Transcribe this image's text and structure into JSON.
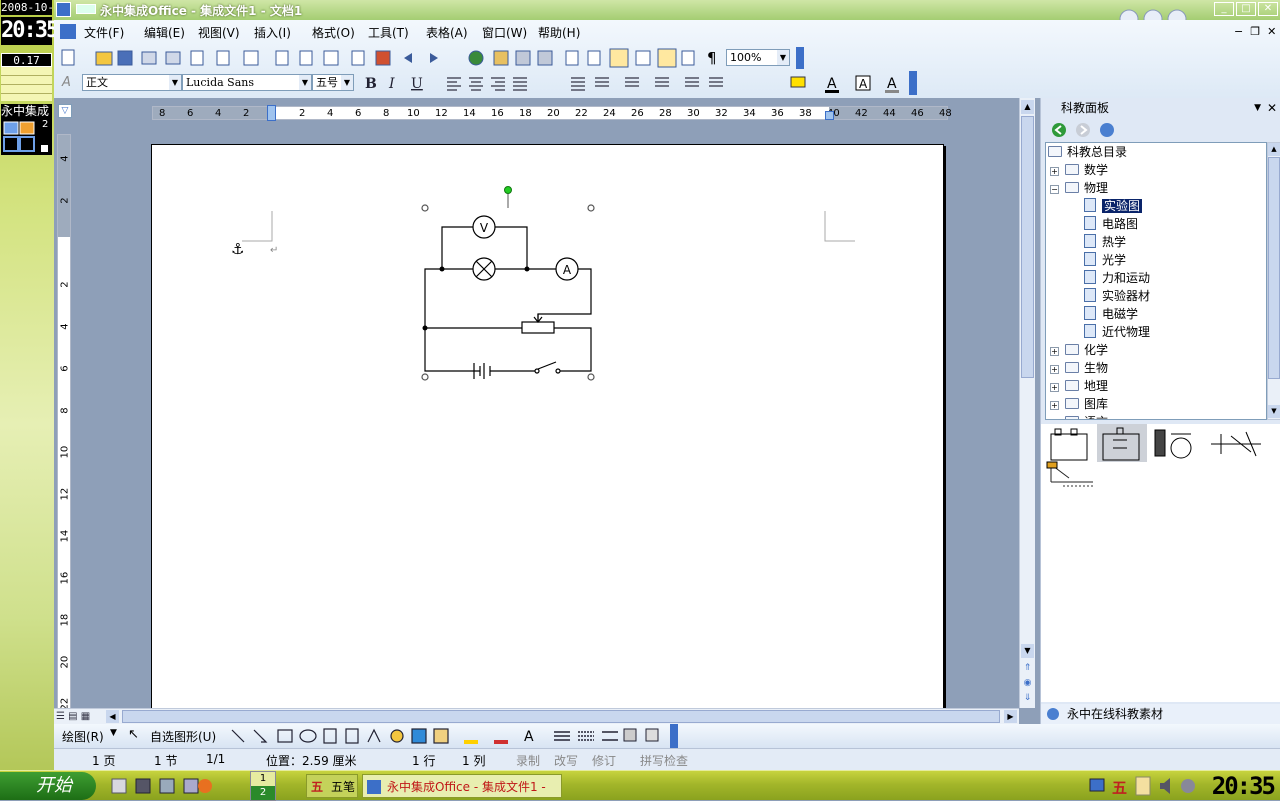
{
  "desktop": {
    "date": "2008-10-",
    "clock": "20:35",
    "meter": "0.17",
    "widget_label": "永中集成",
    "widget_count": "2"
  },
  "window": {
    "title": "永中集成Office - 集成文件1 - 文档1"
  },
  "menu": [
    "文件(F)",
    "编辑(E)",
    "视图(V)",
    "插入(I)",
    "格式(O)",
    "工具(T)",
    "表格(A)",
    "窗口(W)",
    "帮助(H)"
  ],
  "toolbar": {
    "zoom": "100%"
  },
  "format": {
    "style": "正文",
    "font": "Lucida Sans",
    "size": "五号"
  },
  "ruler": {
    "h_ticks": [
      "8",
      "6",
      "4",
      "2",
      "",
      "2",
      "4",
      "6",
      "8",
      "10",
      "12",
      "14",
      "16",
      "18",
      "20",
      "22",
      "24",
      "26",
      "28",
      "30",
      "32",
      "34",
      "36",
      "38",
      "40",
      "42",
      "44",
      "46",
      "48"
    ],
    "v_ticks": [
      "4",
      "2",
      "",
      "2",
      "4",
      "6",
      "8",
      "10",
      "12",
      "14",
      "16",
      "18",
      "20",
      "22"
    ]
  },
  "panel": {
    "title": "科教面板",
    "root": "科教总目录",
    "tree": [
      {
        "label": "数学",
        "level": 1,
        "expander": "+"
      },
      {
        "label": "物理",
        "level": 1,
        "expander": "−"
      },
      {
        "label": "实验图",
        "level": 2,
        "selected": true
      },
      {
        "label": "电路图",
        "level": 2
      },
      {
        "label": "热学",
        "level": 2
      },
      {
        "label": "光学",
        "level": 2
      },
      {
        "label": "力和运动",
        "level": 2
      },
      {
        "label": "实验器材",
        "level": 2
      },
      {
        "label": "电磁学",
        "level": 2
      },
      {
        "label": "近代物理",
        "level": 2
      },
      {
        "label": "化学",
        "level": 1,
        "expander": "+"
      },
      {
        "label": "生物",
        "level": 1,
        "expander": "+"
      },
      {
        "label": "地理",
        "level": 1,
        "expander": "+"
      },
      {
        "label": "图库",
        "level": 1,
        "expander": "+"
      },
      {
        "label": "语言",
        "level": 1,
        "expander": "+"
      }
    ],
    "footer": "永中在线科教素材"
  },
  "drawbar": {
    "draw": "绘图(R)",
    "autoshape": "自选图形(U)"
  },
  "circuit": {
    "voltmeter": "V",
    "ammeter": "A"
  },
  "status": {
    "page": "1 页",
    "section": "1 节",
    "pages": "1/1",
    "position": "位置：2.59 厘米",
    "line": "1 行",
    "col": "1 列",
    "rec": "录制",
    "ovr": "改写",
    "trk": "修订",
    "spell": "拼写检查"
  },
  "taskbar": {
    "start": "开始",
    "ime": "五笔",
    "task": "永中集成Office - 集成文件1 -",
    "ws1": "1",
    "ws2": "2",
    "clock": "20:35"
  },
  "colors": {
    "accent": "#a4cd72",
    "selected": "#0a246a",
    "green_dot": "#22cc22"
  }
}
